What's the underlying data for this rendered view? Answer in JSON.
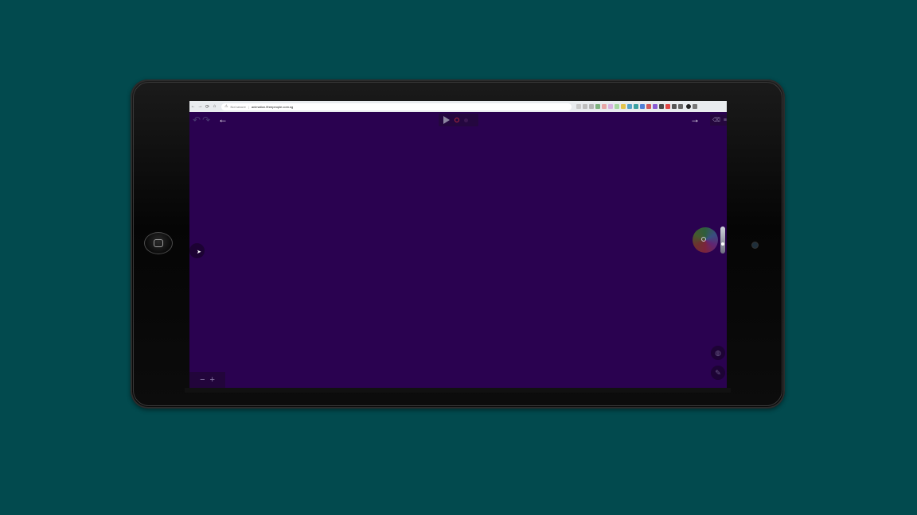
{
  "browser": {
    "back": "←",
    "forward": "→",
    "reload": "⟳",
    "home": "⌂",
    "security_label": "Not secure",
    "url": "animation.ffreepeople.com.sg",
    "separator": "|"
  },
  "app": {
    "undo": "↶",
    "redo": "↷",
    "prev_arrow": "←",
    "next_arrow": "→",
    "zoom_out": "−",
    "zoom_in": "+",
    "eraser_icon": "⌫",
    "menu_icon": "≡",
    "cursor": "➤",
    "layer_icon": "◍",
    "brush_icon": "✎"
  },
  "colors": {
    "background": "#024a4e",
    "canvas": "#2a0250",
    "record": "#b3283c"
  }
}
